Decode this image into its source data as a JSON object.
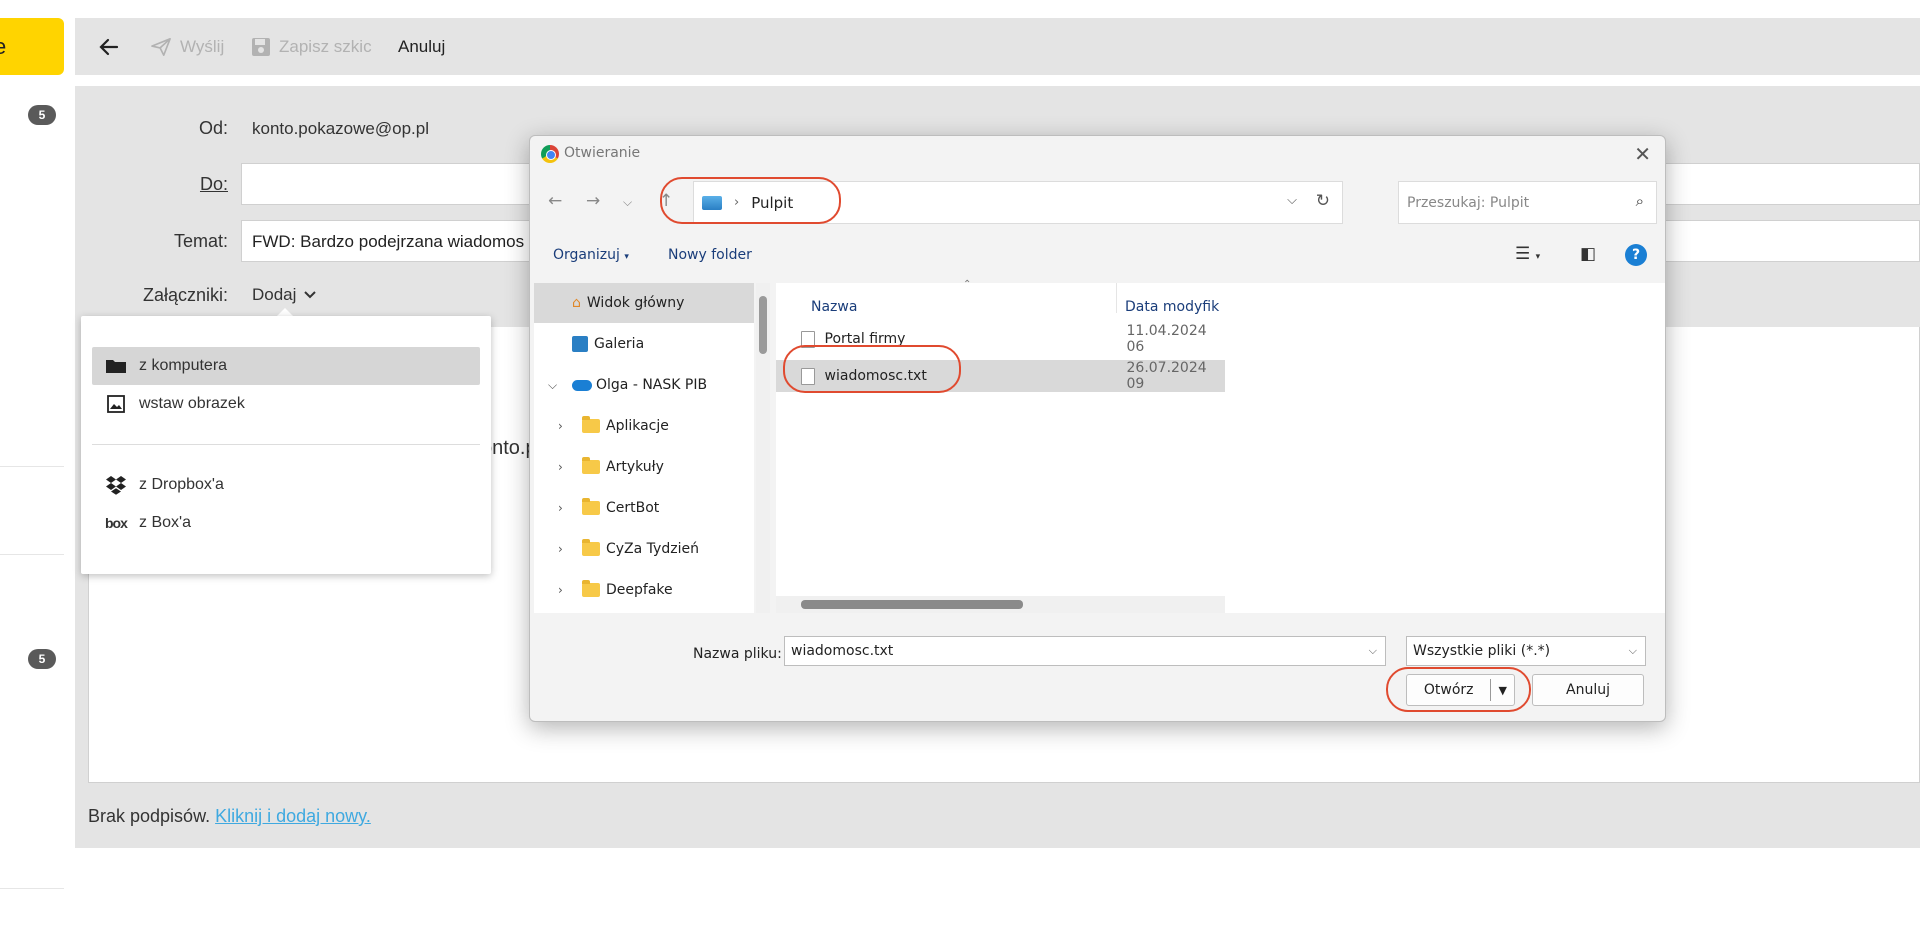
{
  "toolbar": {
    "back_icon": "arrow-left-icon",
    "send_label": "Wyślij",
    "save_draft_label": "Zapisz szkic",
    "cancel_label": "Anuluj"
  },
  "left_strip": {
    "button_label": "e",
    "badges": [
      "5",
      "5"
    ],
    "accent_color": "#ffd400"
  },
  "compose": {
    "from_label": "Od:",
    "from_value": "konto.pokazowe@op.pl",
    "to_label": "Do:",
    "to_value": "",
    "subject_label": "Temat:",
    "subject_value": "FWD: Bardzo podejrzana wiadomos",
    "attachments_label": "Załączniki:",
    "attachments_add": "Dodaj",
    "body_partial_text": "onto.p",
    "signature_text": "Brak podpisów.",
    "signature_link": "Kliknij i dodaj nowy."
  },
  "attach_menu": {
    "items": [
      {
        "label": "z komputera",
        "icon": "folder-icon"
      },
      {
        "label": "wstaw obrazek",
        "icon": "image-icon"
      },
      {
        "label": "z Dropbox'a",
        "icon": "dropbox-icon"
      },
      {
        "label": "z Box'a",
        "icon": "box-icon"
      }
    ],
    "box_glyph": "box"
  },
  "dialog": {
    "title": "Otwieranie",
    "address": "Pulpit",
    "search_placeholder": "Przeszukaj: Pulpit",
    "organize_label": "Organizuj",
    "new_folder_label": "Nowy folder",
    "help_glyph": "?",
    "nav_items": [
      {
        "label": "Widok główny"
      },
      {
        "label": "Galeria"
      },
      {
        "label": "Olga - NASK PIB"
      },
      {
        "label": "Aplikacje"
      },
      {
        "label": "Artykuły"
      },
      {
        "label": "CertBot"
      },
      {
        "label": "CyZa Tydzień"
      },
      {
        "label": "Deepfake"
      }
    ],
    "columns": {
      "name": "Nazwa",
      "date": "Data modyfik"
    },
    "files": [
      {
        "name": "Portal firmy",
        "date": "11.04.2024 06"
      },
      {
        "name": "wiadomosc.txt",
        "date": "26.07.2024 09"
      }
    ],
    "filename_label": "Nazwa pliku:",
    "filename_value": "wiadomosc.txt",
    "filetype_value": "Wszystkie pliki (*.*)",
    "open_label": "Otwórz",
    "cancel_label": "Anuluj",
    "highlight_color": "#e04a2f"
  }
}
